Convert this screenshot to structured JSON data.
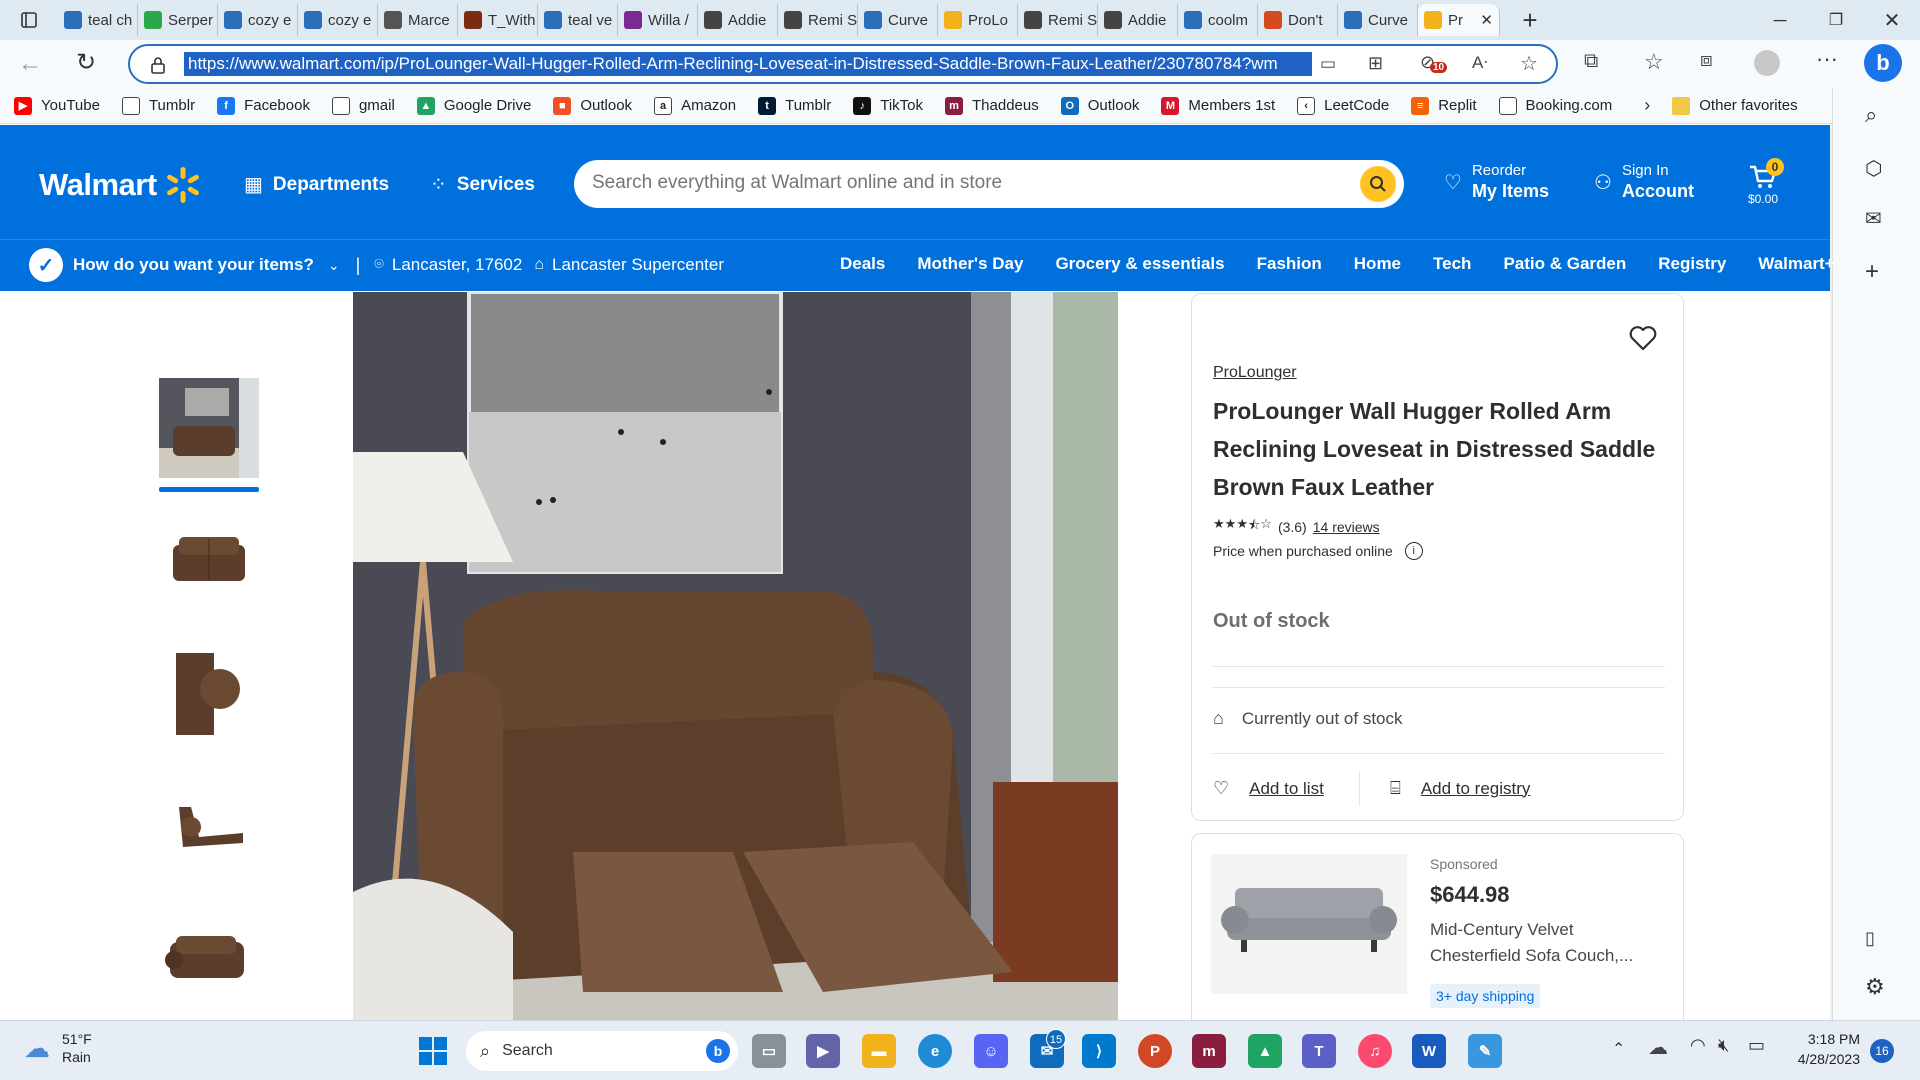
{
  "browser": {
    "tabs": [
      {
        "label": "teal ch",
        "fav": "search-icon",
        "color": "#2b6fb8"
      },
      {
        "label": "Serper",
        "fav": "h-icon",
        "color": "#2aa84a"
      },
      {
        "label": "cozy e",
        "fav": "b-icon",
        "color": "#2b6fb8"
      },
      {
        "label": "cozy e",
        "fav": "b-icon",
        "color": "#2b6fb8"
      },
      {
        "label": "Marce",
        "fav": "g-icon",
        "color": "#555"
      },
      {
        "label": "T_With",
        "fav": "t-icon",
        "color": "#7a2b10"
      },
      {
        "label": "teal ve",
        "fav": "b-icon",
        "color": "#2b6fb8"
      },
      {
        "label": "Willa /",
        "fav": "diamond-icon",
        "color": "#7b2a94"
      },
      {
        "label": "Addie",
        "fav": "we-icon",
        "color": "#444"
      },
      {
        "label": "Remi S",
        "fav": "we-icon",
        "color": "#444"
      },
      {
        "label": "Curve",
        "fav": "search-icon",
        "color": "#2b6fb8"
      },
      {
        "label": "ProLo",
        "fav": "walmart-spark-icon",
        "color": "#f2b21c"
      },
      {
        "label": "Remi S",
        "fav": "we-icon",
        "color": "#444"
      },
      {
        "label": "Addie",
        "fav": "we-icon",
        "color": "#444"
      },
      {
        "label": "coolm",
        "fav": "search-icon",
        "color": "#2b6fb8"
      },
      {
        "label": "Don't",
        "fav": "c-icon",
        "color": "#d44b1f"
      },
      {
        "label": "Curve",
        "fav": "search-icon",
        "color": "#2b6fb8"
      },
      {
        "label": "Pr",
        "fav": "walmart-spark-icon",
        "color": "#f2b21c",
        "active": true
      }
    ],
    "url": "https://www.walmart.com/ip/ProLounger-Wall-Hugger-Rolled-Arm-Reclining-Loveseat-in-Distressed-Saddle-Brown-Faux-Leather/230780784?wm",
    "extensions_badge": "10",
    "bookmarks": [
      {
        "label": "YouTube",
        "icon": "youtube-icon",
        "color": "#ff0000",
        "glyph": "▶"
      },
      {
        "label": "Tumblr",
        "icon": "page-icon",
        "color": "#fff",
        "glyph": ""
      },
      {
        "label": "Facebook",
        "icon": "facebook-icon",
        "color": "#1877f2",
        "glyph": "f"
      },
      {
        "label": "gmail",
        "icon": "page-icon",
        "color": "#fff",
        "glyph": ""
      },
      {
        "label": "Google Drive",
        "icon": "google-drive-icon",
        "color": "#1fa463",
        "glyph": "▲"
      },
      {
        "label": "Outlook",
        "icon": "windows-icon",
        "color": "#f25022",
        "glyph": "■"
      },
      {
        "label": "Amazon",
        "icon": "amazon-icon",
        "color": "#fff",
        "glyph": "a"
      },
      {
        "label": "Tumblr",
        "icon": "tumblr-icon",
        "color": "#001935",
        "glyph": "t"
      },
      {
        "label": "TikTok",
        "icon": "tiktok-icon",
        "color": "#111",
        "glyph": "♪"
      },
      {
        "label": "Thaddeus",
        "icon": "thaddeus-icon",
        "color": "#8b1e3f",
        "glyph": "m"
      },
      {
        "label": "Outlook",
        "icon": "outlook-icon",
        "color": "#0f6cbd",
        "glyph": "O"
      },
      {
        "label": "Members 1st",
        "icon": "m-icon",
        "color": "#d6162b",
        "glyph": "M"
      },
      {
        "label": "LeetCode",
        "icon": "leetcode-icon",
        "color": "#fff",
        "glyph": "‹"
      },
      {
        "label": "Replit",
        "icon": "replit-icon",
        "color": "#f26207",
        "glyph": "≡"
      },
      {
        "label": "Booking.com",
        "icon": "page-icon",
        "color": "#fff",
        "glyph": ""
      }
    ],
    "other_favorites": "Other favorites"
  },
  "header": {
    "logo": "Walmart",
    "departments": "Departments",
    "services": "Services",
    "search_placeholder": "Search everything at Walmart online and in store",
    "reorder_top": "Reorder",
    "reorder_bottom": "My Items",
    "signin_top": "Sign In",
    "signin_bottom": "Account",
    "cart_count": "0",
    "cart_total": "$0.00"
  },
  "subnav": {
    "delivery_question": "How do you want your items?",
    "location": "Lancaster, 17602",
    "store": "Lancaster Supercenter",
    "links": [
      "Deals",
      "Mother's Day",
      "Grocery & essentials",
      "Fashion",
      "Home",
      "Tech",
      "Patio & Garden",
      "Registry",
      "Walmart+"
    ]
  },
  "product": {
    "brand": "ProLounger",
    "title": "ProLounger Wall Hugger Rolled Arm Reclining Loveseat in Distressed Saddle Brown Faux Leather",
    "rating": 3.6,
    "rating_text": "(3.6)",
    "reviews": "14 reviews",
    "price_note": "Price when purchased online",
    "stock_status": "Out of stock",
    "availability": "Currently out of stock",
    "add_to_list": "Add to list",
    "add_to_registry": "Add to registry"
  },
  "sponsored": {
    "label": "Sponsored",
    "price": "$644.98",
    "name_line1": "Mid-Century Velvet",
    "name_line2": "Chesterfield Sofa Couch,...",
    "shipping": "3+ day shipping"
  },
  "taskbar": {
    "weather_temp": "51°F",
    "weather_cond": "Rain",
    "search": "Search",
    "mail_badge": "15",
    "time": "3:18 PM",
    "date": "4/28/2023",
    "notifications": "16"
  }
}
